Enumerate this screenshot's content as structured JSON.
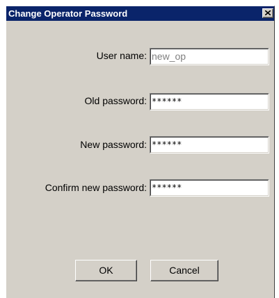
{
  "window": {
    "title": "Change Operator Password",
    "title_bar_color": "#0a246a",
    "background_color": "#d4d0c8",
    "close_icon": "close-icon"
  },
  "form": {
    "user_name": {
      "label": "User name:",
      "value": "new_op"
    },
    "old_password": {
      "label": "Old password:",
      "value": "******"
    },
    "new_password": {
      "label": "New password:",
      "value": "******"
    },
    "confirm_password": {
      "label": "Confirm new password:",
      "value": "******"
    }
  },
  "buttons": {
    "ok_label": "OK",
    "cancel_label": "Cancel"
  }
}
